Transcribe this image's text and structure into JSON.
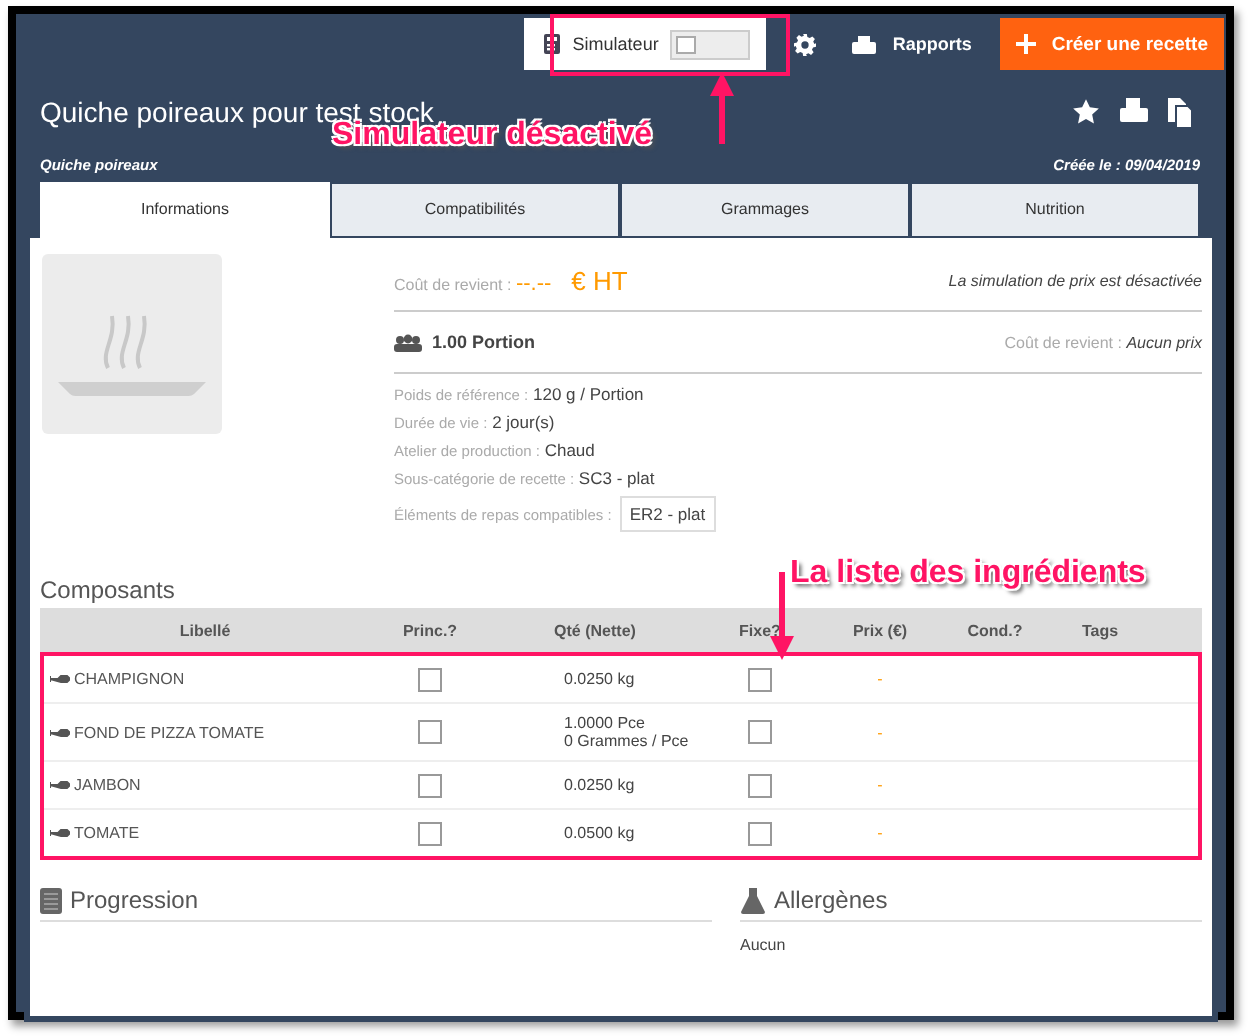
{
  "top_bar": {
    "simulator": {
      "label": "Simulateur",
      "on": false
    },
    "reports": "Rapports",
    "create_button": "Créer une recette"
  },
  "recipe": {
    "title": "Quiche poireaux pour test stock",
    "subtitle": "Quiche poireaux",
    "created": "Créée le : 09/04/2019",
    "tabs": [
      {
        "label": "Informations",
        "selected": true
      },
      {
        "label": "Compatibilités",
        "selected": false
      },
      {
        "label": "Grammages",
        "selected": false
      },
      {
        "label": "Nutrition",
        "selected": false
      }
    ],
    "cost": {
      "label": "Coût de revient :",
      "value": "--.--",
      "unit": "€ HT",
      "note": "La simulation de prix est désactivée"
    },
    "portion": "1.00 Portion",
    "unit_cost": {
      "label": "Coût de revient :",
      "value": "Aucun prix"
    },
    "details": [
      {
        "label": "Poids de référence :",
        "value": "120 g / Portion"
      },
      {
        "label": "Durée de vie :",
        "value": "2 jour(s)"
      },
      {
        "label": "Atelier de production :",
        "value": "Chaud"
      },
      {
        "label": "Sous-catégorie de recette :",
        "value": "SC3 - plat"
      }
    ],
    "compatible": {
      "label": "Éléments de repas compatibles :",
      "tags": [
        "ER2 - plat"
      ]
    }
  },
  "components": {
    "title": "Composants",
    "columns": [
      "Libellé",
      "Princ.?",
      "Qté (Nette)",
      "Fixe?",
      "Prix (€)",
      "Cond.?",
      "Tags"
    ],
    "rows": [
      {
        "name": "CHAMPIGNON",
        "main": false,
        "qty": [
          "0.0250  kg"
        ],
        "fixed": false,
        "price": "-"
      },
      {
        "name": "FOND DE PIZZA TOMATE",
        "main": false,
        "qty": [
          "1.0000  Pce",
          "0  Grammes / Pce"
        ],
        "fixed": false,
        "price": "-"
      },
      {
        "name": "JAMBON",
        "main": false,
        "qty": [
          "0.0250  kg"
        ],
        "fixed": false,
        "price": "-"
      },
      {
        "name": "TOMATE",
        "main": false,
        "qty": [
          "0.0500  kg"
        ],
        "fixed": false,
        "price": "-"
      }
    ]
  },
  "progression": {
    "title": "Progression"
  },
  "allergens": {
    "title": "Allergènes",
    "value": "Aucun"
  },
  "annotations": [
    {
      "kind": "simulator",
      "text": "Simulateur désactivé"
    },
    {
      "kind": "list",
      "text": "La liste des ingrédients"
    }
  ]
}
